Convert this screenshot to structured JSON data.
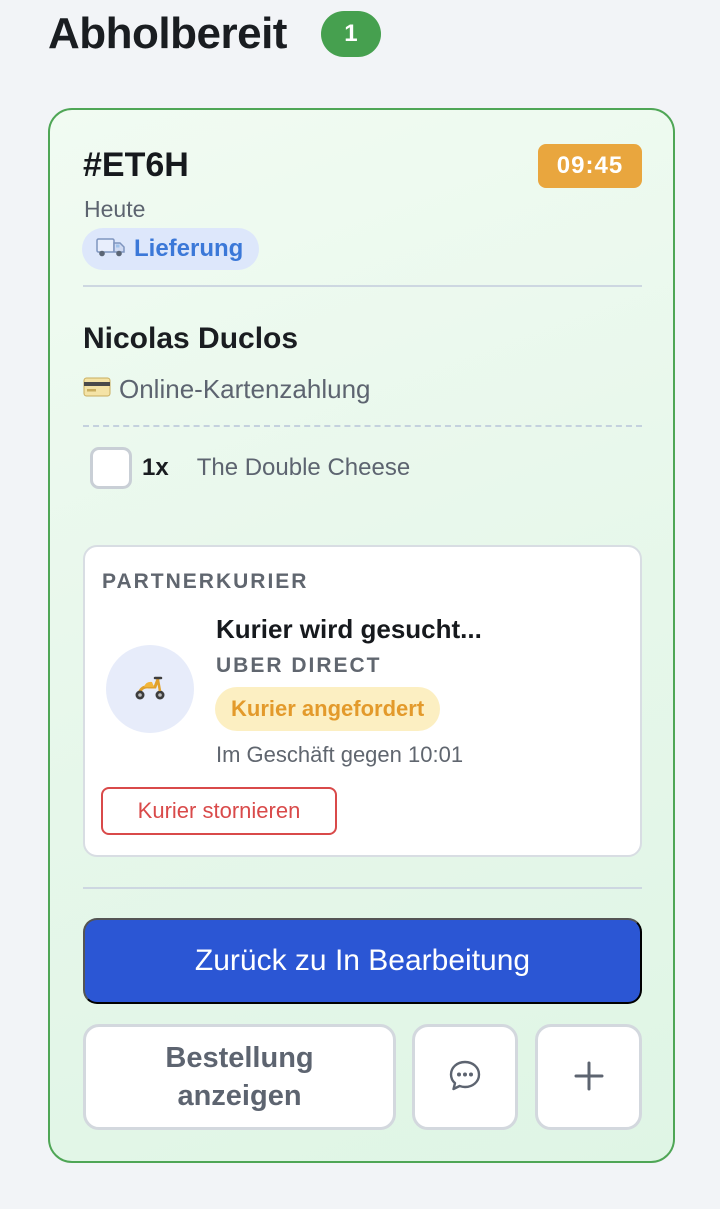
{
  "section": {
    "title": "Abholbereit",
    "count": "1"
  },
  "order": {
    "id": "#ET6H",
    "time": "09:45",
    "day": "Heute",
    "type_label": "Lieferung",
    "type_icon": "truck-icon",
    "customer_name": "Nicolas Duclos",
    "payment_label": "Online-Kartenzahlung",
    "payment_icon": "credit-card-icon",
    "items": [
      {
        "qty": "1x",
        "name": "The Double Cheese",
        "checked": false
      }
    ]
  },
  "courier": {
    "section_title": "PARTNERKURIER",
    "avatar_icon": "scooter-icon",
    "status": "Kurier wird gesucht...",
    "provider": "UBER DIRECT",
    "badge": "Kurier angefordert",
    "eta": "Im Geschäft gegen 10:01",
    "cancel_label": "Kurier stornieren"
  },
  "actions": {
    "primary_label": "Zurück zu In Bearbeitung",
    "view_order_label": "Bestellung anzeigen",
    "chat_icon": "chat-icon",
    "add_icon": "plus-icon"
  },
  "colors": {
    "ready_green": "#46a04f",
    "time_badge": "#e9a63e",
    "primary_blue": "#2b56d4",
    "danger_red": "#d94a4a",
    "courier_badge_text": "#e39a2b"
  }
}
